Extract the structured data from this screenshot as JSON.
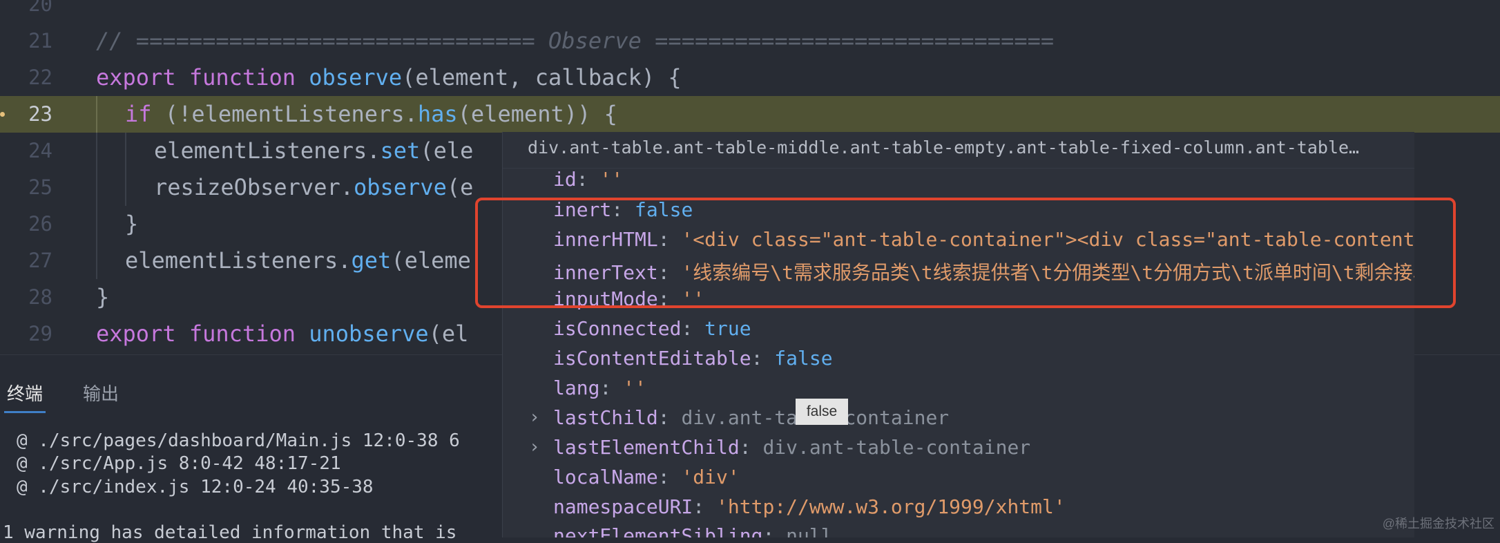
{
  "editor": {
    "lines": [
      {
        "num": "20"
      },
      {
        "num": "21",
        "comment": "// ============================== Observe =============================="
      },
      {
        "num": "22",
        "kw1": "export",
        "kw2": "function",
        "fn": "observe",
        "rest": "(element, callback) {"
      },
      {
        "num": "23",
        "kw": "if",
        "a": " (!elementListeners.",
        "fn": "has",
        "b": "(element)) {"
      },
      {
        "num": "24",
        "a": "elementListeners.",
        "fn": "set",
        "b": "(ele"
      },
      {
        "num": "25",
        "a": "resizeObserver.",
        "fn": "observe",
        "b": "(e"
      },
      {
        "num": "26",
        "a": "}"
      },
      {
        "num": "27",
        "a": "elementListeners.",
        "fn": "get",
        "b": "(eleme"
      },
      {
        "num": "28",
        "a": "}"
      },
      {
        "num": "29",
        "kw1": "export",
        "kw2": "function",
        "fn": "unobserve",
        "rest": "(el"
      }
    ]
  },
  "panel": {
    "tabs": [
      "终端",
      "输出"
    ],
    "terminal_lines": [
      "@ ./src/pages/dashboard/Main.js 12:0-38 6",
      "@ ./src/App.js 8:0-42 48:17-21",
      "@ ./src/index.js 12:0-24 40:35-38",
      "1 warning has detailed information that is"
    ]
  },
  "tooltip": {
    "header": "div.ant-table.ant-table-middle.ant-table-empty.ant-table-fixed-column.ant-table…",
    "props": [
      {
        "key": "id",
        "value": "''",
        "type": "str"
      },
      {
        "key": "inert",
        "value": "false",
        "type": "bool"
      },
      {
        "key": "innerHTML",
        "value": "'<div class=\"ant-table-container\"><div class=\"ant-table-content\" sty",
        "type": "str"
      },
      {
        "key": "innerText",
        "value": "'线索编号\\t需求服务品类\\t线索提供者\\t分佣类型\\t分佣方式\\t派单时间\\t剩余接单时间",
        "type": "str"
      },
      {
        "key": "inputMode",
        "value": "''",
        "type": "str"
      },
      {
        "key": "isConnected",
        "value": "true",
        "type": "bool"
      },
      {
        "key": "isContentEditable",
        "value": "false",
        "type": "bool"
      },
      {
        "key": "lang",
        "value": "''",
        "type": "str"
      },
      {
        "key": "lastChild",
        "value": "div.ant-table-container",
        "type": "obj",
        "expandable": true
      },
      {
        "key": "lastElementChild",
        "value": "div.ant-table-container",
        "type": "obj",
        "expandable": true
      },
      {
        "key": "localName",
        "value": "'div'",
        "type": "str"
      },
      {
        "key": "namespaceURI",
        "value": "'http://www.w3.org/1999/xhtml'",
        "type": "str"
      },
      {
        "key": "nextElementSibling",
        "value": "null",
        "type": "obj"
      }
    ],
    "mini_tooltip": "false"
  },
  "watermark": "@稀土掘金技术社区",
  "colors": {
    "background": "#282c34",
    "highlight": "#4f5234",
    "annotation_box": "#e0442e",
    "keyword": "#c678dd",
    "function": "#61afef",
    "string": "#e09b6a"
  }
}
